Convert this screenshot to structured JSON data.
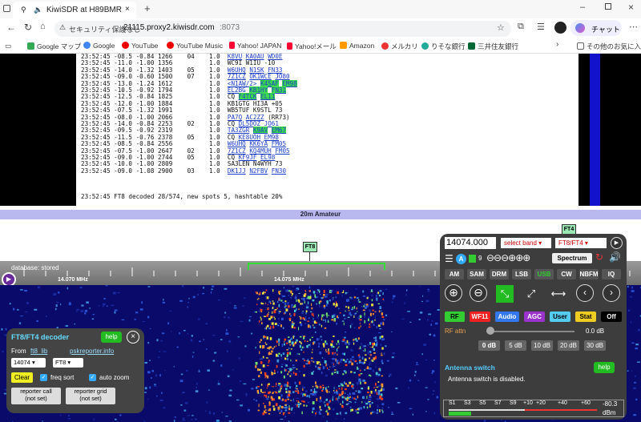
{
  "browser": {
    "tab_title": "KiwiSDR at H89BMR",
    "security_label": "セキュリティ保護なし",
    "url_host": "21115.proxy2.kiwisdr.com",
    "url_port": ":8073",
    "chat_label": "チャット",
    "bookmarks": [
      "Google マップ",
      "Google",
      "YouTube",
      "YouTube Music",
      "Yahoo! JAPAN",
      "Yahoo!メール",
      "Amazon",
      "メルカリ",
      "りそな銀行",
      "三井住友銀行"
    ],
    "other_bookmarks": "その他のお気に入り"
  },
  "decodes": [
    {
      "t": "23:52:45",
      "snr": "-08.5",
      "dt": "-0.84",
      "freq": "1266",
      "z": "04",
      "snr2": "1.0",
      "msg": [
        [
          "K8VU",
          1,
          0
        ],
        [
          "KA0AU",
          1,
          0
        ],
        [
          "WD0E",
          1,
          0
        ]
      ]
    },
    {
      "t": "23:52:45",
      "snr": "-11.0",
      "dt": "-1.00",
      "freq": "1356",
      "z": "",
      "snr2": "1.0",
      "msg": [
        [
          "WC9I W1IU -10",
          0,
          0
        ]
      ]
    },
    {
      "t": "23:52:45",
      "snr": "-14.0",
      "dt": "-1.32",
      "freq": "1403",
      "z": "05",
      "snr2": "1.0",
      "msg": [
        [
          "W6UHQ",
          1,
          0
        ],
        [
          "N1SK",
          1,
          0
        ],
        [
          "FN33",
          1,
          0
        ]
      ]
    },
    {
      "t": "23:52:45",
      "snr": "-09.0",
      "dt": "-0.60",
      "freq": "1500",
      "z": "07",
      "snr2": "1.0",
      "msg": [
        [
          "7Z1CZ",
          1,
          0
        ],
        [
          "OK1WCE",
          1,
          0
        ],
        [
          "JO80",
          1,
          0
        ]
      ]
    },
    {
      "t": "23:52:45",
      "snr": "-13.0",
      "dt": "-1.24",
      "freq": "1612",
      "z": "",
      "snr2": "1.0",
      "msg": [
        [
          "<N1AW/2>",
          1,
          0
        ],
        [
          "K4SAF",
          1,
          1
        ],
        [
          "EM98",
          1,
          1
        ]
      ]
    },
    {
      "t": "23:52:45",
      "snr": "-10.5",
      "dt": "-0.92",
      "freq": "1794",
      "z": "",
      "snr2": "1.0",
      "msg": [
        [
          "EL2BG",
          1,
          0
        ],
        [
          "KB1HY",
          1,
          1
        ],
        [
          "FN31",
          1,
          1
        ]
      ]
    },
    {
      "t": "23:52:45",
      "snr": "-12.5",
      "dt": "-0.84",
      "freq": "1825",
      "z": "",
      "snr2": "1.0",
      "msg": [
        [
          "CQ",
          0,
          0
        ],
        [
          "F4TCK",
          1,
          1
        ],
        [
          "EL11",
          1,
          1
        ]
      ]
    },
    {
      "t": "23:52:45",
      "snr": "-12.0",
      "dt": "-1.00",
      "freq": "1884",
      "z": "",
      "snr2": "1.0",
      "msg": [
        [
          "KB1GTG HI3A +05",
          0,
          0
        ]
      ]
    },
    {
      "t": "23:52:45",
      "snr": "-07.5",
      "dt": "-1.32",
      "freq": "1991",
      "z": "",
      "snr2": "1.0",
      "msg": [
        [
          "WB5TUF K9STL 73",
          0,
          0
        ]
      ]
    },
    {
      "t": "23:52:45",
      "snr": "-08.0",
      "dt": "-1.00",
      "freq": "2066",
      "z": "",
      "snr2": "1.0",
      "msg": [
        [
          "PA7Q",
          1,
          0
        ],
        [
          "AC2ZZ",
          1,
          0
        ],
        [
          "(RR73)",
          0,
          0
        ]
      ]
    },
    {
      "t": "23:52:45",
      "snr": "-14.0",
      "dt": "-0.84",
      "freq": "2253",
      "z": "02",
      "snr2": "1.0",
      "msg": [
        [
          "CQ",
          0,
          0
        ],
        [
          "DL5DOZ",
          1,
          0
        ],
        [
          "JO61",
          1,
          0
        ]
      ]
    },
    {
      "t": "23:52:45",
      "snr": "-09.5",
      "dt": "-0.92",
      "freq": "2319",
      "z": "",
      "snr2": "1.0",
      "msg": [
        [
          "TA3ZGR",
          1,
          0
        ],
        [
          "K9AV",
          1,
          1
        ],
        [
          "EM67",
          1,
          1
        ]
      ]
    },
    {
      "t": "23:52:45",
      "snr": "-11.5",
      "dt": "-0.76",
      "freq": "2378",
      "z": "05",
      "snr2": "1.0",
      "msg": [
        [
          "CQ",
          0,
          0
        ],
        [
          "KE8UOH",
          1,
          0
        ],
        [
          "EM98",
          1,
          0
        ]
      ]
    },
    {
      "t": "23:52:45",
      "snr": "-08.5",
      "dt": "-0.84",
      "freq": "2556",
      "z": "",
      "snr2": "1.0",
      "msg": [
        [
          "W6UHQ",
          1,
          0
        ],
        [
          "KK6YA",
          1,
          0
        ],
        [
          "FM05",
          1,
          0
        ]
      ]
    },
    {
      "t": "23:52:45",
      "snr": "-07.5",
      "dt": "-1.00",
      "freq": "2647",
      "z": "02",
      "snr2": "1.0",
      "msg": [
        [
          "7Z1CZ",
          1,
          0
        ],
        [
          "KQ4MUH",
          1,
          0
        ],
        [
          "FM05",
          1,
          0
        ]
      ]
    },
    {
      "t": "23:52:45",
      "snr": "-09.0",
      "dt": "-1.00",
      "freq": "2744",
      "z": "05",
      "snr2": "1.0",
      "msg": [
        [
          "CQ",
          0,
          0
        ],
        [
          "KF9JF",
          1,
          0
        ],
        [
          "EL98",
          1,
          0
        ]
      ]
    },
    {
      "t": "23:52:45",
      "snr": "-10.0",
      "dt": "-1.00",
      "freq": "2809",
      "z": "",
      "snr2": "1.0",
      "msg": [
        [
          "SA3LEN N4WYH 73",
          0,
          0
        ]
      ]
    },
    {
      "t": "23:52:45",
      "snr": "-09.0",
      "dt": "-1.08",
      "freq": "2900",
      "z": "03",
      "snr2": "1.0",
      "msg": [
        [
          "DK1JJ",
          1,
          0
        ],
        [
          "N2FBV",
          1,
          0
        ],
        [
          "FN30",
          1,
          0
        ]
      ]
    }
  ],
  "decode_summary": "23:52:45 FT8 decoded 28/574, new spots 5, hashtable 20%",
  "band_label": "20m Amateur",
  "markers": {
    "ft8": "FT8",
    "ft4": "FT4"
  },
  "scale": {
    "db_status": "database: stored",
    "freq1": "14.070 MHz",
    "freq2": "14.075 MHz"
  },
  "control": {
    "frequency": "14074.000",
    "band_select": "select band",
    "mode_select": "FT8/FT4",
    "mode_digit": "9",
    "spectrum": "Spectrum",
    "modes": [
      "AM",
      "SAM",
      "DRM",
      "LSB",
      "USB",
      "CW",
      "NBFM",
      "IQ"
    ],
    "active_mode": "USB",
    "buttons": [
      {
        "label": "RF",
        "bg": "#33cc33",
        "fg": "#000"
      },
      {
        "label": "WF11",
        "bg": "#ee2222",
        "fg": "#fff"
      },
      {
        "label": "Audio",
        "bg": "#3377ee",
        "fg": "#fff"
      },
      {
        "label": "AGC",
        "bg": "#9933cc",
        "fg": "#fff"
      },
      {
        "label": "User",
        "bg": "#55ccee",
        "fg": "#000"
      },
      {
        "label": "Stat",
        "bg": "#eecc22",
        "fg": "#000"
      },
      {
        "label": "Off",
        "bg": "#000",
        "fg": "#fff"
      }
    ],
    "rf_attn_label": "RF attn",
    "rf_attn_value": "0.0 dB",
    "rf_attn_level": 0,
    "attn_steps": [
      "0 dB",
      "5 dB",
      "10 dB",
      "20 dB",
      "30 dB"
    ],
    "antenna_title": "Antenna switch",
    "antenna_help": "help",
    "antenna_status": "Antenna switch is disabled.",
    "smeter_labels": [
      "S1",
      "S3",
      "S5",
      "S7",
      "S9",
      "+10",
      "+20",
      "+40",
      "+60"
    ],
    "smeter_value": "-80.3",
    "smeter_unit": "dBm"
  },
  "ft8": {
    "title": "FT8/FT4 decoder",
    "help": "help",
    "from_label": "From",
    "link1": "ft8_lib",
    "link2": "pskreporter.info",
    "freq": "14074",
    "mode": "FT8",
    "clear": "Clear",
    "freq_sort": "freq sort",
    "auto_zoom": "auto zoom",
    "reporter_call": "reporter call",
    "reporter_grid": "reporter grid",
    "not_set": "(not set)"
  }
}
